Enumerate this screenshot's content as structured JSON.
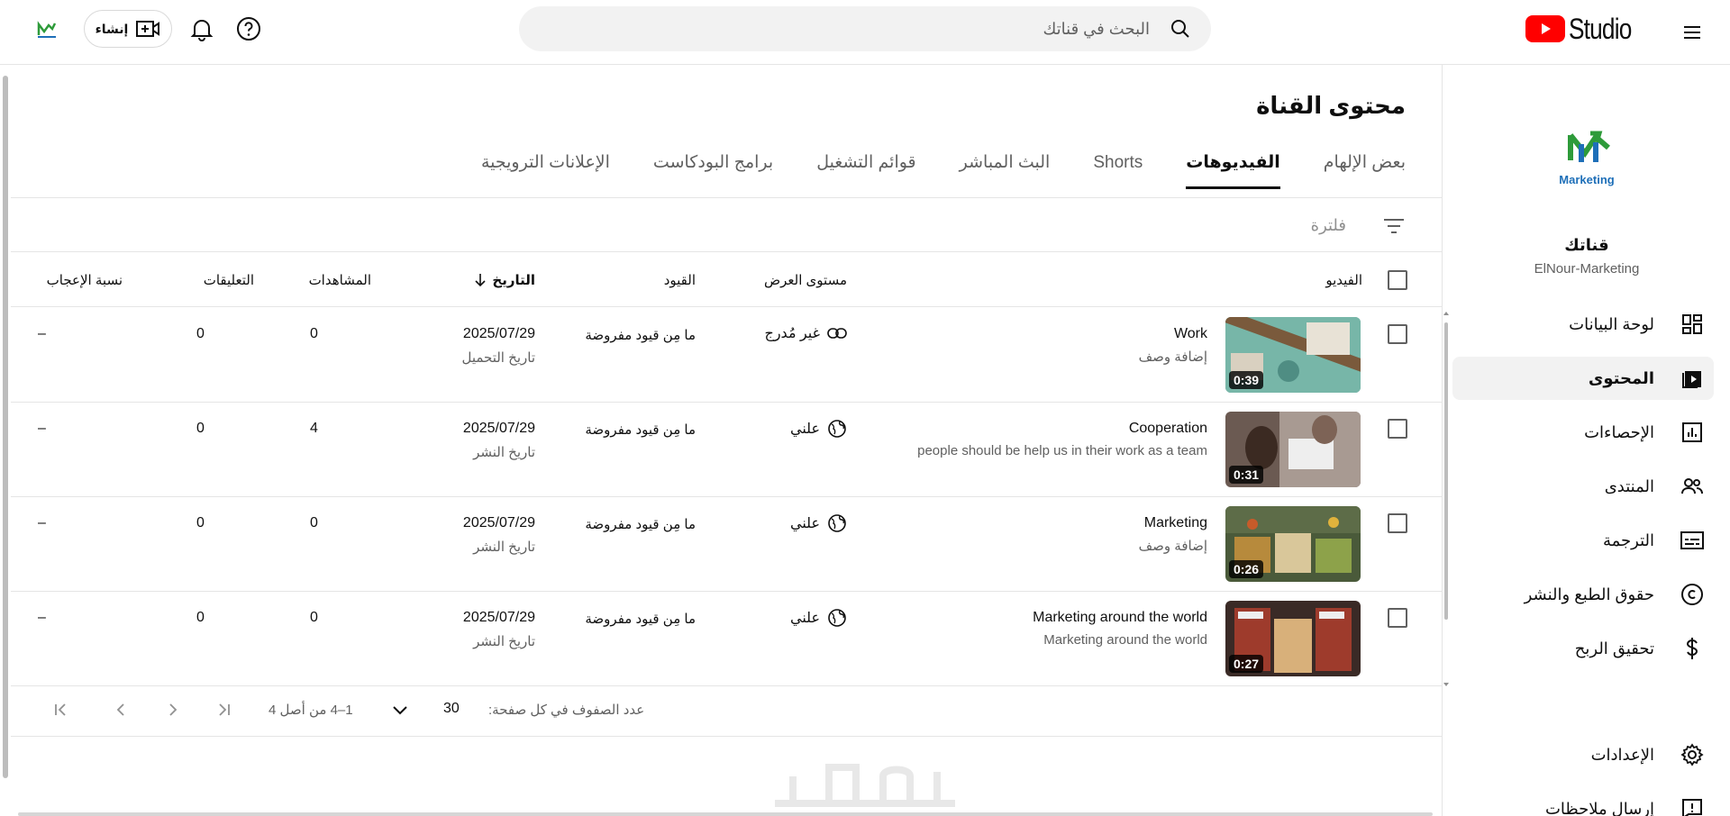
{
  "header": {
    "logo_text": "Studio",
    "search_placeholder": "البحث في قناتك",
    "create_label": "إنشاء"
  },
  "sidebar": {
    "channel_title": "قناتك",
    "channel_handle": "ElNour-Marketing",
    "logo_text": "Marketing",
    "items": [
      {
        "label": "لوحة البيانات",
        "icon": "dashboard-icon"
      },
      {
        "label": "المحتوى",
        "icon": "content-icon",
        "active": true
      },
      {
        "label": "الإحصاءات",
        "icon": "analytics-icon"
      },
      {
        "label": "المنتدى",
        "icon": "community-icon"
      },
      {
        "label": "الترجمة",
        "icon": "subtitles-icon"
      },
      {
        "label": "حقوق الطبع والنشر",
        "icon": "copyright-icon"
      },
      {
        "label": "تحقيق الربح",
        "icon": "dollar-icon"
      },
      {
        "label": "الإعدادات",
        "icon": "gear-icon"
      },
      {
        "label": "إرسال ملاحظات",
        "icon": "feedback-icon"
      }
    ]
  },
  "main": {
    "title": "محتوى القناة",
    "tabs": [
      "بعض الإلهام",
      "الفيديوهات",
      "Shorts",
      "البث المباشر",
      "قوائم التشغيل",
      "برامج البودكاست",
      "الإعلانات الترويجية"
    ],
    "active_tab": 1,
    "filter_placeholder": "فلترة",
    "columns": {
      "video": "الفيديو",
      "visibility": "مستوى العرض",
      "restrictions": "القيود",
      "date": "التاريخ",
      "views": "المشاهدات",
      "comments": "التعليقات",
      "likes": "نسبة الإعجاب"
    },
    "rows": [
      {
        "title": "Work",
        "desc": "إضافة وصف",
        "duration": "0:39",
        "visibility": "غير مُدرج",
        "vis_icon": "link-icon",
        "restrictions": "ما مِن قيود مفروضة",
        "date": "2025/07/29",
        "date_type": "تاريخ التحميل",
        "views": "0",
        "comments": "0",
        "likes": "–"
      },
      {
        "title": "Cooperation",
        "desc": "people should be help us in their work as a team",
        "duration": "0:31",
        "visibility": "علني",
        "vis_icon": "globe-icon",
        "restrictions": "ما مِن قيود مفروضة",
        "date": "2025/07/29",
        "date_type": "تاريخ النشر",
        "views": "4",
        "comments": "0",
        "likes": "–"
      },
      {
        "title": "Marketing",
        "desc": "إضافة وصف",
        "duration": "0:26",
        "visibility": "علني",
        "vis_icon": "globe-icon",
        "restrictions": "ما مِن قيود مفروضة",
        "date": "2025/07/29",
        "date_type": "تاريخ النشر",
        "views": "0",
        "comments": "0",
        "likes": "–"
      },
      {
        "title": "Marketing around the world",
        "desc": "Marketing around the world",
        "duration": "0:27",
        "visibility": "علني",
        "vis_icon": "globe-icon",
        "restrictions": "ما مِن قيود مفروضة",
        "date": "2025/07/29",
        "date_type": "تاريخ النشر",
        "views": "0",
        "comments": "0",
        "likes": "–"
      }
    ],
    "pagination": {
      "rows_per_page_label": "عدد الصفوف في كل صفحة:",
      "rows_per_page": "30",
      "range": "1–4 من أصل 4"
    }
  },
  "colors": {
    "brand_red": "#ff0000",
    "logo_green": "#2e9b3a",
    "logo_blue": "#1e6fb8"
  }
}
